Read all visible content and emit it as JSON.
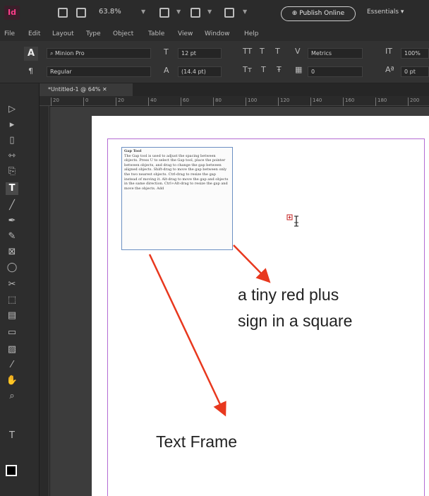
{
  "appbar": {
    "logo": "Id",
    "zoom": "63.8%",
    "publish_label": "Publish Online",
    "workspace": "Essentials"
  },
  "menu": [
    "File",
    "Edit",
    "Layout",
    "Type",
    "Object",
    "Table",
    "View",
    "Window",
    "Help"
  ],
  "control": {
    "char_mode": "A",
    "para_mode": "¶",
    "font_family": "Minion Pro",
    "font_style": "Regular",
    "font_size": "12 pt",
    "leading": "(14.4 pt)",
    "kerning": "Metrics",
    "tracking": "0",
    "scale": "100%",
    "baseline": "0 pt"
  },
  "document": {
    "tab_title": "*Untitled-1 @ 64%",
    "ruler_labels": [
      "20",
      "0",
      "20",
      "40",
      "60",
      "80",
      "100",
      "120",
      "140",
      "160",
      "180",
      "200"
    ]
  },
  "text_frame": {
    "heading": "Gap Tool",
    "body": "The Gap tool is used to adjust the spacing between objects. Press U to select the Gap tool, place the pointer between objects, and drag to change the gap between aligned objects. Shift-drag to move the gap between only the two nearest objects. Ctrl-drag to resize the gap instead of moving it. Alt-drag to move the gap and objects in the same direction. Ctrl+Alt-drag to resize the gap and move the objects. Add"
  },
  "annotations": {
    "plus_line1": "a tiny red plus",
    "plus_line2": "sign in a square",
    "frame_label": "Text Frame"
  },
  "colors": {
    "arrow": "#e8381e",
    "margin_guide": "#b46bd3",
    "frame_border": "#6b8fc2"
  }
}
